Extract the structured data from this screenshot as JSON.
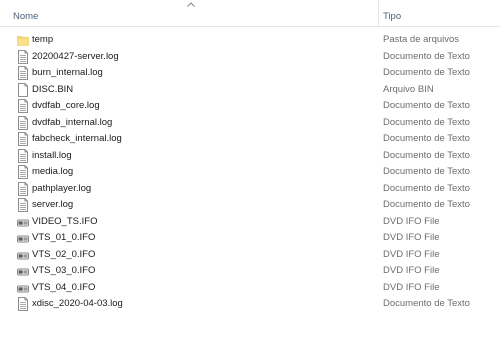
{
  "columns": {
    "name": "Nome",
    "type": "Tipo"
  },
  "files": [
    {
      "name": "temp",
      "type": "Pasta de arquivos",
      "icon": "folder"
    },
    {
      "name": "20200427-server.log",
      "type": "Documento de Texto",
      "icon": "text-document"
    },
    {
      "name": "burn_internal.log",
      "type": "Documento de Texto",
      "icon": "text-document"
    },
    {
      "name": "DISC.BIN",
      "type": "Arquivo BIN",
      "icon": "blank-file"
    },
    {
      "name": "dvdfab_core.log",
      "type": "Documento de Texto",
      "icon": "text-document"
    },
    {
      "name": "dvdfab_internal.log",
      "type": "Documento de Texto",
      "icon": "text-document"
    },
    {
      "name": "fabcheck_internal.log",
      "type": "Documento de Texto",
      "icon": "text-document"
    },
    {
      "name": "install.log",
      "type": "Documento de Texto",
      "icon": "text-document"
    },
    {
      "name": "media.log",
      "type": "Documento de Texto",
      "icon": "text-document"
    },
    {
      "name": "pathplayer.log",
      "type": "Documento de Texto",
      "icon": "text-document"
    },
    {
      "name": "server.log",
      "type": "Documento de Texto",
      "icon": "text-document"
    },
    {
      "name": "VIDEO_TS.IFO",
      "type": "DVD IFO File",
      "icon": "dvd-ifo-file"
    },
    {
      "name": "VTS_01_0.IFO",
      "type": "DVD IFO File",
      "icon": "dvd-ifo-file"
    },
    {
      "name": "VTS_02_0.IFO",
      "type": "DVD IFO File",
      "icon": "dvd-ifo-file"
    },
    {
      "name": "VTS_03_0.IFO",
      "type": "DVD IFO File",
      "icon": "dvd-ifo-file"
    },
    {
      "name": "VTS_04_0.IFO",
      "type": "DVD IFO File",
      "icon": "dvd-ifo-file"
    },
    {
      "name": "xdisc_2020-04-03.log",
      "type": "Documento de Texto",
      "icon": "text-document"
    }
  ]
}
